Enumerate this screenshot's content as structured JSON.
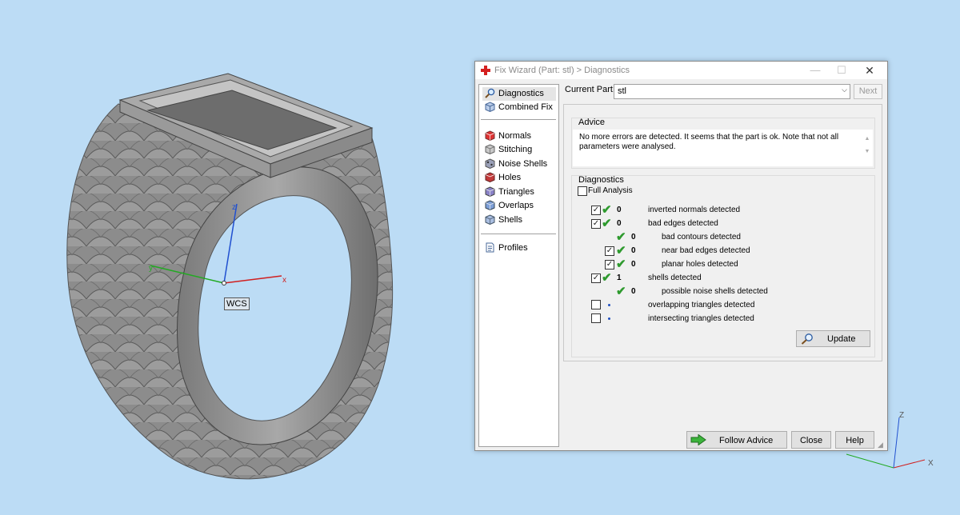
{
  "window": {
    "title": "Fix Wizard (Part: stl) > Diagnostics",
    "minimize": "—",
    "maximize": "☐",
    "close": "✕"
  },
  "viewport": {
    "wcs_label": "WCS",
    "axis_x": "x",
    "axis_y": "y",
    "axis_z": "z",
    "corner_axis_x": "X",
    "corner_axis_z": "Z"
  },
  "nav": {
    "items_top": [
      {
        "label": "Diagnostics",
        "icon": "magnifier-icon",
        "selected": true
      },
      {
        "label": "Combined Fix",
        "icon": "cube-icon"
      }
    ],
    "items_mid": [
      {
        "label": "Normals",
        "icon": "normals-icon"
      },
      {
        "label": "Stitching",
        "icon": "stitching-icon"
      },
      {
        "label": "Noise Shells",
        "icon": "noise-shells-icon"
      },
      {
        "label": "Holes",
        "icon": "holes-icon"
      },
      {
        "label": "Triangles",
        "icon": "triangles-icon"
      },
      {
        "label": "Overlaps",
        "icon": "overlaps-icon"
      },
      {
        "label": "Shells",
        "icon": "shells-icon"
      }
    ],
    "items_bottom": [
      {
        "label": "Profiles",
        "icon": "document-icon"
      }
    ]
  },
  "top": {
    "current_part_label": "Current Part:",
    "current_part_value": "stl",
    "next_label": "Next"
  },
  "advice": {
    "title": "Advice",
    "text": "No more errors are detected. It seems that the part is ok. Note that not all parameters were analysed."
  },
  "diagnostics": {
    "title": "Diagnostics",
    "full_analysis_label": "Full Analysis",
    "full_analysis_checked": false,
    "rows": [
      {
        "checked": true,
        "status": "ok",
        "count": "0",
        "label": "inverted normals detected"
      },
      {
        "checked": true,
        "status": "ok",
        "count": "0",
        "label": "bad edges detected"
      },
      {
        "checked": null,
        "status": "ok",
        "count": "0",
        "label": "bad contours detected"
      },
      {
        "checked": true,
        "status": "ok",
        "count": "0",
        "label": "near bad edges detected"
      },
      {
        "checked": true,
        "status": "ok",
        "count": "0",
        "label": "planar holes detected"
      },
      {
        "checked": true,
        "status": "ok",
        "count": "1",
        "label": "shells detected"
      },
      {
        "checked": null,
        "status": "ok",
        "count": "0",
        "label": "possible noise shells detected"
      },
      {
        "checked": false,
        "status": "pending",
        "count": "",
        "label": "overlapping triangles detected"
      },
      {
        "checked": false,
        "status": "pending",
        "count": "",
        "label": "intersecting triangles detected"
      }
    ],
    "update_label": "Update"
  },
  "buttons": {
    "follow_advice": "Follow Advice",
    "close": "Close",
    "help": "Help"
  },
  "colors": {
    "background": "#bcdcf5",
    "ok_check": "#2e9a2e",
    "pending_dot": "#1f4fbf",
    "ring_gray": "#8a8a8a"
  }
}
